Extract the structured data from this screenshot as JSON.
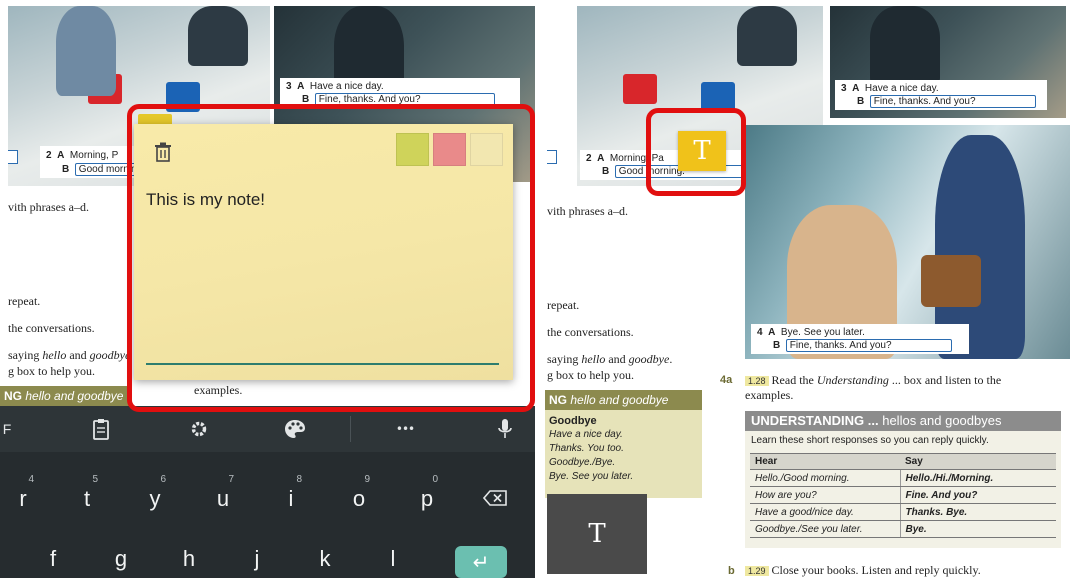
{
  "left": {
    "captions": {
      "c3": {
        "num": "3",
        "a": "A",
        "a_text": "Have a nice day.",
        "b": "B",
        "b_text": "Fine, thanks. And you?"
      },
      "c2": {
        "num": "2",
        "a": "A",
        "a_text": "Morning, P",
        "b": "B",
        "b_text": "Good mornin"
      }
    },
    "body_lines": {
      "l1": "vith phrases a–d.",
      "l2": "repeat.",
      "l3": "the conversations.",
      "l4a": "saying ",
      "l4b": "hello",
      "l4c": " and ",
      "l4d": "goodbye",
      "l5": "g box to help you.",
      "l6": "examples."
    },
    "section_bar": {
      "bold": "NG",
      "italic": "hello and goodbye"
    },
    "note": {
      "text": "This is my note!",
      "swatches": [
        {
          "name": "green",
          "color": "#cfd35a"
        },
        {
          "name": "pink",
          "color": "#e98a8a"
        },
        {
          "name": "cream",
          "color": "#f2e7b0"
        }
      ]
    },
    "keyboard": {
      "toolbar": {
        "clipboard": "📋",
        "settings": "⚙",
        "palette": "🎨",
        "more": "•••",
        "mic": "🎤"
      },
      "row1": [
        {
          "key": "r",
          "hint": "4"
        },
        {
          "key": "t",
          "hint": "5"
        },
        {
          "key": "y",
          "hint": "6"
        },
        {
          "key": "u",
          "hint": "7"
        },
        {
          "key": "i",
          "hint": "8"
        },
        {
          "key": "o",
          "hint": "9"
        },
        {
          "key": "p",
          "hint": "0"
        }
      ],
      "row2": [
        "f",
        "g",
        "h",
        "j",
        "k",
        "l"
      ],
      "backspace": "⌫",
      "enter": "↵",
      "left_partial": "F"
    }
  },
  "right": {
    "captions": {
      "c3": {
        "num": "3",
        "a": "A",
        "a_text": "Have a nice day.",
        "b": "B",
        "b_text": "Fine, thanks. And you?"
      },
      "c2": {
        "num": "2",
        "a": "A",
        "a_text": "Morning, Pa",
        "b": "B",
        "b_text": "Good morning."
      },
      "c4": {
        "num": "4",
        "a": "A",
        "a_text": "Bye. See you later.",
        "b": "B",
        "b_text": "Fine, thanks. And you?"
      }
    },
    "t_badge": "T",
    "t_dark": "T",
    "body_lines": {
      "l1": "vith phrases a–d.",
      "l2": "repeat.",
      "l3": "the conversations.",
      "l4a": "saying ",
      "l4b": "hello",
      "l4c": " and ",
      "l4d": "goodbye",
      "l4e": ".",
      "l5": "g box to help you."
    },
    "section_bar": {
      "bold": "NG",
      "italic": "hello and goodbye"
    },
    "phrases": {
      "title": "Goodbye",
      "items": [
        "Have a nice day.",
        "Thanks. You too.",
        "Goodbye./Bye.",
        "Bye. See you later."
      ]
    },
    "ex4a": {
      "label": "4a",
      "audio": "1.28",
      "text1": " Read the ",
      "text2": "Understanding",
      "text3": " ... box and listen to the",
      "text4": "examples."
    },
    "understanding": {
      "title_bold": "UNDERSTANDING ...",
      "title_rest": " hellos and goodbyes",
      "desc": "Learn these short responses so you can reply quickly.",
      "headers": [
        "Hear",
        "Say"
      ],
      "rows": [
        [
          "Hello./Good morning.",
          "Hello./Hi./Morning."
        ],
        [
          "How are you?",
          "Fine. And you?"
        ],
        [
          "Have a good/nice day.",
          "Thanks. Bye."
        ],
        [
          "Goodbye./See you later.",
          "Bye."
        ]
      ]
    },
    "exb": {
      "label": "b",
      "audio": "1.29",
      "text": " Close your books. Listen and reply quickly."
    }
  }
}
